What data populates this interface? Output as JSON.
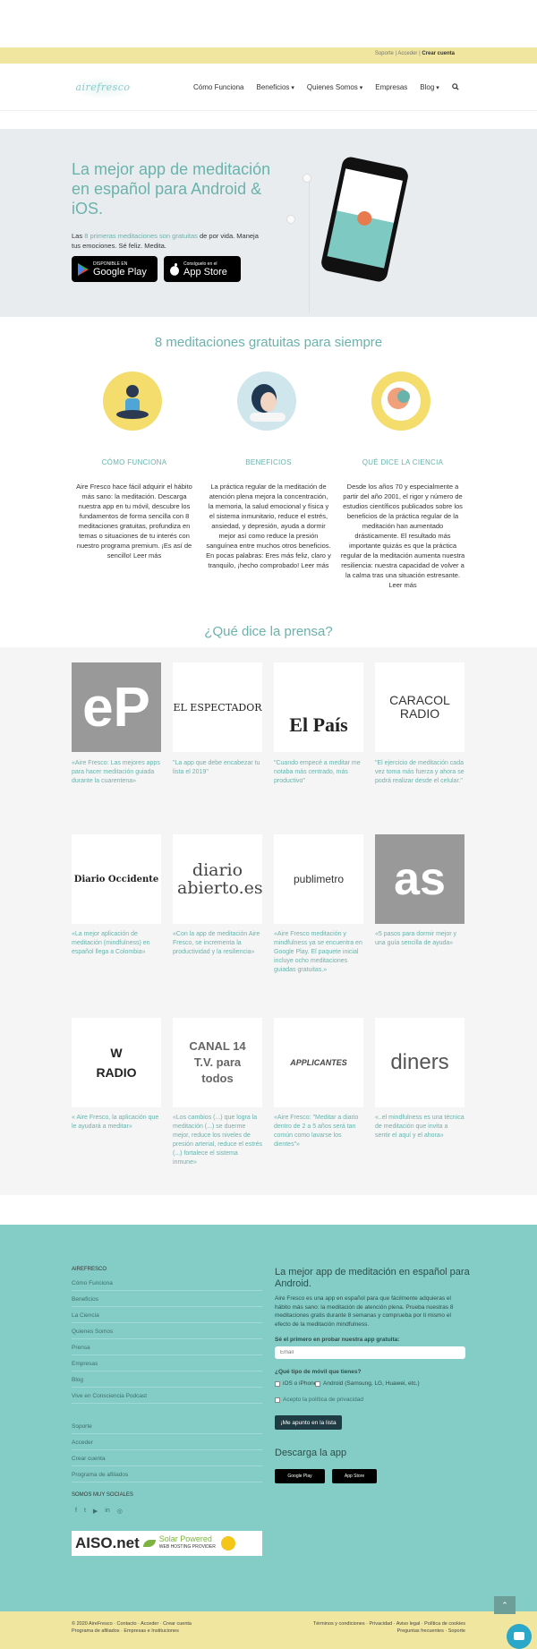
{
  "utilbar": {
    "soporte": "Soporte",
    "acceder": "Acceder",
    "crear": "Crear cuenta"
  },
  "header": {
    "logo_text": "airefresco",
    "nav": [
      "Cómo Funciona",
      "Beneficios",
      "Quienes Somos",
      "Empresas",
      "Blog"
    ]
  },
  "hero": {
    "title": "La mejor app de meditación en español para Android & iOS.",
    "text_pre": "Las ",
    "text_link": "8 primeras meditaciones son gratuitas",
    "text_post": " de por vida. Maneja tus emociones. Sé feliz. Medita.",
    "google_sub": "DISPONIBLE EN",
    "google_main": "Google Play",
    "apple_sub": "Consíguelo en el",
    "apple_main": "App Store"
  },
  "features": {
    "title": "8 meditaciones gratuitas para siempre",
    "items": [
      {
        "heading": "CÓMO FUNCIONA",
        "text": "Aire Fresco hace fácil adquirir el hábito más sano: la meditación. Descarga nuestra app en tu móvil, descubre los fundamentos de forma sencilla con 8 meditaciones gratuitas, profundiza en temas o situaciones de tu interés con nuestro programa premium. ¡Es así de sencillo! Leer más"
      },
      {
        "heading": "BENEFICIOS",
        "text": "La práctica regular de la meditación de atención plena mejora la concentración, la memoria, la salud emocional y física y el sistema inmunitario, reduce el estrés, ansiedad, y depresión, ayuda a dormir mejor así como reduce la presión sanguínea entre muchos otros beneficios. En pocas palabras: Eres más feliz, claro y tranquilo, ¡hecho comprobado! Leer más"
      },
      {
        "heading": "QUÉ DICE LA CIENCIA",
        "text": "Desde los años 70 y especialmente a partir del año 2001, el rigor y número de estudios científicos publicados sobre los beneficios de la práctica regular de la meditación han aumentado drásticamente. El resultado más importante quizás es que la práctica regular de la meditación aumenta nuestra resiliencia: nuestra capacidad de volver a la calma tras una situación estresante. Leer más"
      }
    ]
  },
  "press": {
    "title": "¿Qué dice la prensa?",
    "items": [
      {
        "logo": "eP",
        "quote": "«Aire Fresco: Las mejores apps para hacer meditación guiada durante la cuarentena»"
      },
      {
        "logo": "EL ESPECTADOR",
        "quote": "\"La app que debe encabezar tu lista el 2019\""
      },
      {
        "logo": "El País",
        "quote": "\"Cuando empecé a meditar me notaba más centrado, más productivo\""
      },
      {
        "logo": "CARACOL RADIO",
        "quote": "\"El ejercicio de meditación cada vez toma más fuerza y ahora se podrá realizar desde el celular.\""
      },
      {
        "logo": "Diario Occidente",
        "quote": "«La mejor aplicación de meditación (mindfulness) en español llega a Colombia»"
      },
      {
        "logo": "diario abierto.es",
        "quote": "«Con la app de meditación Aire Fresco, se incrementa la productividad y la resiliencia»"
      },
      {
        "logo": "publimetro",
        "quote": "«Aire Fresco meditación y mindfulness ya se encuentra en Google Play. El paquete inicial incluye ocho meditaciones guiadas gratuitas.»"
      },
      {
        "logo": "as",
        "quote": "«5 pasos para dormir mejor y una guía sencilla de ayuda»"
      },
      {
        "logo": "W RADIO",
        "quote": "« Aire Fresco, la aplicación que le ayudará a meditar»"
      },
      {
        "logo": "CANAL 14 T.V. para todos",
        "quote": "«Los cambios (...) que logra la meditación (...) se duerme mejor, reduce los niveles de presión arterial, reduce el estrés (...) fortalece el sistema inmune»"
      },
      {
        "logo": "APPLICANTES",
        "quote": "«Aire Fresco: \"Meditar a diario dentro de 2 a 5 años será tan común como lavarse los dientes\"»"
      },
      {
        "logo": "diners",
        "quote": "«..el mindfulness es una técnica de meditación que invita a sentir el aquí y el ahora»"
      }
    ]
  },
  "footer": {
    "col_title": "AIREFRESCO",
    "links": [
      "Cómo Funciona",
      "Beneficios",
      "La Ciencia",
      "Quienes Somos",
      "Prensa",
      "Empresas",
      "Blog",
      "Vive en Consciencia Podcast"
    ],
    "links2": [
      "Soporte",
      "Acceder",
      "Crear cuenta",
      "Programa de afiliados"
    ],
    "social_title": "SOMOS MUY SOCIALES",
    "social_icons": [
      "facebook-icon",
      "twitter-icon",
      "youtube-icon",
      "linkedin-icon",
      "instagram-icon"
    ],
    "aiso_name": "AISO.net",
    "aiso_solar": "Solar Powered",
    "aiso_sub": "WEB HOSTING PROVIDER",
    "signup_title": "La mejor app de meditación en español para Android.",
    "signup_text": "Aire Fresco es una app en español para que fácilmente adquieras el hábito más sano: la meditación de atención plena. Prueba nuestras 8 meditaciones gratis durante 8 semanas y comprueba por ti mismo el efecto de la meditación mindfulness.",
    "first_label": "Sé el primero en probar nuestra app gratuita:",
    "email_placeholder": "Email",
    "phone_label": "¿Qué tipo de móvil que tienes?",
    "opt_ios": "iOS o iPhone",
    "opt_android": "Android (Samsung, LG, Huawei, etc.)",
    "privacy": "Acepto la política de privacidad",
    "submit": "¡Me apunto en la lista",
    "download_title": "Descarga la app",
    "google": "Google Play",
    "apple": "App Store"
  },
  "bottom": {
    "left1": "© 2020 AireFresco · Contacto · Acceder · Crear cuenta",
    "left2": "Programa de afiliados · Empresas e Instituciones",
    "right1": "Términos y condiciones · Privacidad · Aviso legal · Política de cookies",
    "right2": "Preguntas frecuentes · Soporte"
  },
  "colors": {
    "accent": "#6ab3ac",
    "footer": "#84cdc6",
    "yellow": "#f0e6a0"
  }
}
